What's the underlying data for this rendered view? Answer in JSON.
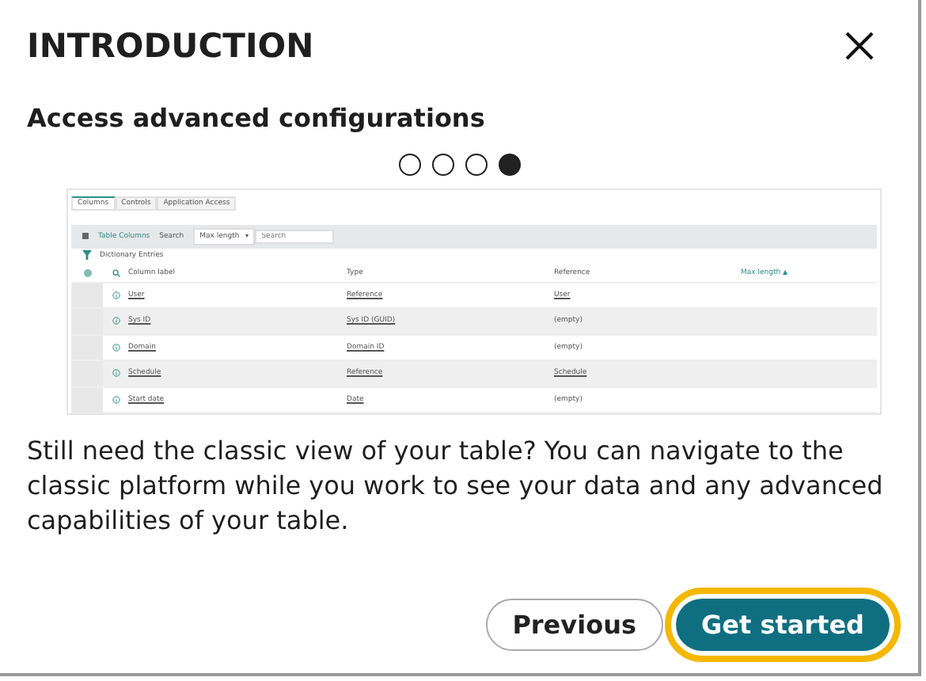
{
  "dialog": {
    "title": "INTRODUCTION",
    "subtitle": "Access advanced configurations",
    "steps": [
      {
        "selected": false
      },
      {
        "selected": false
      },
      {
        "selected": false
      },
      {
        "selected": true
      }
    ],
    "preview": {
      "tabs": [
        {
          "label": "Columns",
          "selected": true
        },
        {
          "label": "Controls",
          "selected": false
        },
        {
          "label": "Application Access",
          "selected": false
        }
      ],
      "toolbar": {
        "title": "Table Columns",
        "search_label": "Search",
        "field_select": "Max length",
        "search_placeholder": "Search"
      },
      "breadcrumb": "Dictionary Entries",
      "columns": [
        {
          "label": "Column label",
          "sorted": false
        },
        {
          "label": "Type",
          "sorted": false
        },
        {
          "label": "Reference",
          "sorted": false
        },
        {
          "label": "Max length",
          "sorted": true
        }
      ],
      "sort_arrow": "▲",
      "rows": [
        {
          "cells": [
            "User",
            "Reference",
            "User"
          ],
          "linked": [
            true,
            true,
            true
          ]
        },
        {
          "cells": [
            "Sys ID",
            "Sys ID (GUID)",
            "(empty)"
          ],
          "linked": [
            true,
            true,
            false
          ]
        },
        {
          "cells": [
            "Domain",
            "Domain ID",
            "(empty)"
          ],
          "linked": [
            true,
            true,
            false
          ]
        },
        {
          "cells": [
            "Schedule",
            "Reference",
            "Schedule"
          ],
          "linked": [
            true,
            true,
            true
          ]
        },
        {
          "cells": [
            "Start date",
            "Date",
            "(empty)"
          ],
          "linked": [
            true,
            true,
            false
          ]
        }
      ]
    },
    "body": "Still need the classic view of your table? You can navigate to the classic platform while you work to see your data and any advanced capabilities of your table.",
    "buttons": [
      {
        "label": "Previous",
        "kind": "secondary",
        "focused": false
      },
      {
        "label": "Get started",
        "kind": "primary",
        "focused": true
      }
    ]
  }
}
